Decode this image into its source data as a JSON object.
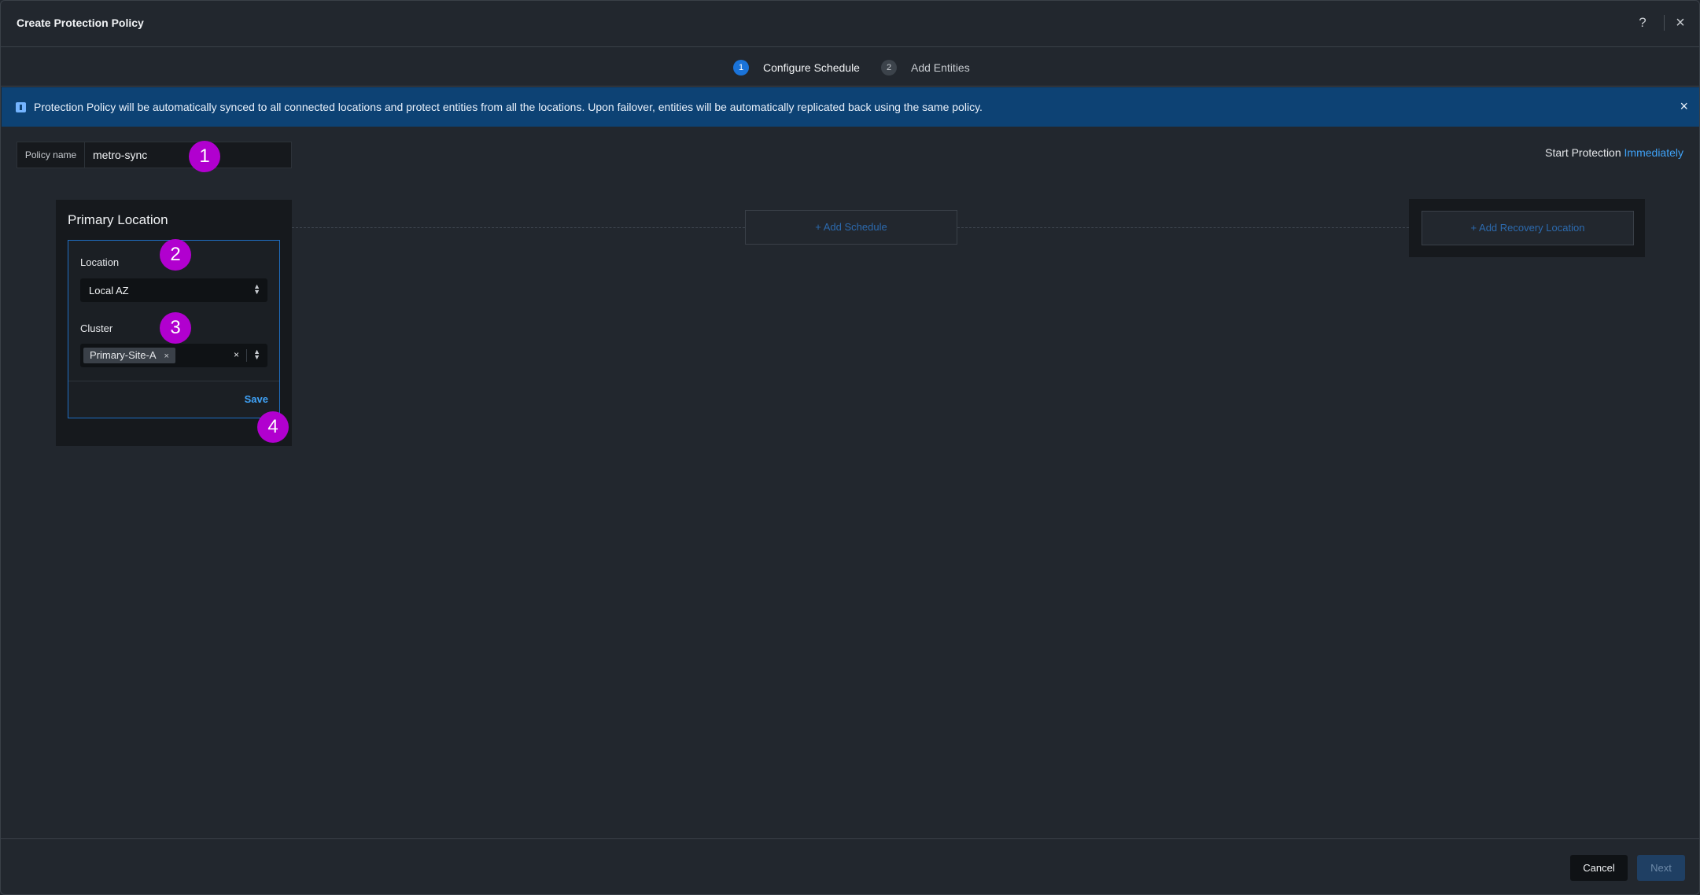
{
  "header": {
    "title": "Create Protection Policy",
    "help_icon": "?",
    "close_icon": "×"
  },
  "stepper": {
    "steps": [
      {
        "number": "1",
        "label": "Configure Schedule",
        "active": true
      },
      {
        "number": "2",
        "label": "Add Entities",
        "active": false
      }
    ]
  },
  "banner": {
    "message": "Protection Policy will be automatically synced to all connected locations and protect entities from all the locations. Upon failover, entities will be automatically replicated back using the same policy.",
    "close_icon": "×",
    "color": "#0d4274"
  },
  "policy": {
    "label": "Policy name",
    "value": "metro-sync"
  },
  "start_protection": {
    "prefix": "Start Protection",
    "link": "Immediately"
  },
  "primary_location": {
    "title": "Primary Location",
    "location_label": "Location",
    "location_value": "Local AZ",
    "cluster_label": "Cluster",
    "cluster_chip": "Primary-Site-A",
    "chip_remove": "×",
    "clear": "×",
    "save_label": "Save"
  },
  "add_schedule_label": "+ Add Schedule",
  "add_recovery_label": "+ Add Recovery Location",
  "markers": [
    "1",
    "2",
    "3",
    "4"
  ],
  "footer": {
    "cancel_label": "Cancel",
    "next_label": "Next"
  },
  "colors": {
    "accent": "#3fa2f7",
    "marker": "#b100cf",
    "background": "#22272e"
  }
}
